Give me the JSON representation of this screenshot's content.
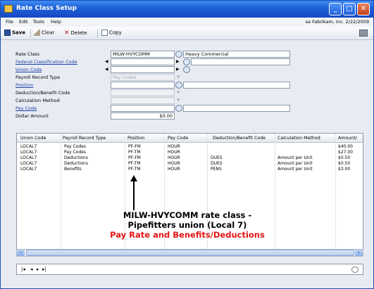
{
  "window": {
    "title": "Rate Class Setup"
  },
  "menu": {
    "items": [
      "File",
      "Edit",
      "Tools",
      "Help"
    ],
    "user_info": "sa  Fabrikam, Inc.  2/22/2009"
  },
  "toolbar": {
    "save": "Save",
    "clear": "Clear",
    "delete": "Delete",
    "copy": "Copy"
  },
  "form": {
    "rate_class_label": "Rate Class",
    "rate_class_value": "MILW-HVYCOMM",
    "rate_class_desc": "Heavy Commercial",
    "federal_label": "Federal Classification Code",
    "union_label": "Union Code",
    "payroll_record_label": "Payroll Record Type",
    "payroll_record_value": "Pay Codes",
    "position_label": "Position",
    "deduction_label": "Deduction/Benefit Code",
    "calc_label": "Calculation Method",
    "paycode_label": "Pay Code",
    "dollar_label": "Dollar Amount",
    "dollar_value": "$0.00"
  },
  "grid": {
    "columns": [
      "Union Code",
      "Payroll Record Type",
      "Position",
      "Pay Code",
      "Deduction/Benefit Code",
      "Calculation Method",
      "Amount/"
    ],
    "rows": [
      [
        "LOCAL7",
        "Pay Codes",
        "PF-FM",
        "HOUR",
        "",
        "",
        "$40.00"
      ],
      [
        "LOCAL7",
        "Pay Codes",
        "PF-TM",
        "HOUR",
        "",
        "",
        "$27.00"
      ],
      [
        "LOCAL7",
        "Deductions",
        "PF-FM",
        "HOUR",
        "DUES",
        "Amount per Unit",
        "$0.50"
      ],
      [
        "LOCAL7",
        "Deductions",
        "PF-TM",
        "HOUR",
        "DUES",
        "Amount per Unit",
        "$0.50"
      ],
      [
        "LOCAL7",
        "Benefits",
        "PF-TM",
        "HOUR",
        "PENS",
        "Amount per Unit",
        "$3.00"
      ]
    ]
  },
  "annotation": {
    "line1": "MILW-HVYCOMM rate class -",
    "line2": "Pipefitters union (Local 7)",
    "line3": "Pay Rate and Benefits/Deductions"
  }
}
